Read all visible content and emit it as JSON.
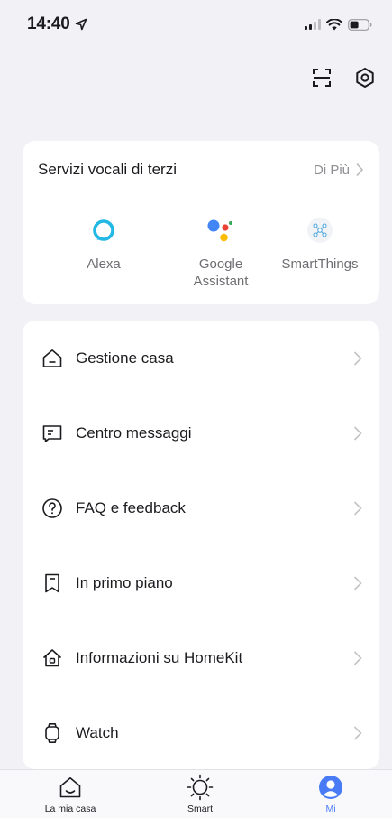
{
  "status_bar": {
    "time": "14:40"
  },
  "voice_services": {
    "title": "Servizi vocali di terzi",
    "more_label": "Di Più",
    "items": [
      {
        "label": "Alexa",
        "icon": "alexa-icon"
      },
      {
        "label": "Google Assistant",
        "icon": "google-assistant-icon"
      },
      {
        "label": "SmartThings",
        "icon": "smartthings-icon"
      }
    ]
  },
  "menu": {
    "items": [
      {
        "label": "Gestione casa",
        "icon": "home-icon"
      },
      {
        "label": "Centro messaggi",
        "icon": "message-icon"
      },
      {
        "label": "FAQ e feedback",
        "icon": "question-icon"
      },
      {
        "label": "In primo piano",
        "icon": "bookmark-icon"
      },
      {
        "label": "Informazioni su HomeKit",
        "icon": "homekit-icon"
      },
      {
        "label": "Watch",
        "icon": "watch-icon"
      }
    ]
  },
  "tab_bar": {
    "tabs": [
      {
        "label": "La mia casa",
        "icon": "home-tab-icon",
        "active": false
      },
      {
        "label": "Smart",
        "icon": "sun-icon",
        "active": false
      },
      {
        "label": "Mi",
        "icon": "profile-icon",
        "active": true
      }
    ]
  },
  "colors": {
    "accent": "#4a7bf7",
    "background": "#f2f2f6",
    "card": "#ffffff"
  }
}
